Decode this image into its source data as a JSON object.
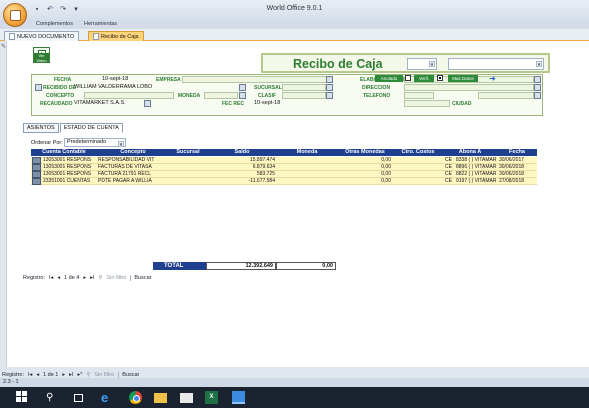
{
  "window": {
    "title": "World Office 9.0.1"
  },
  "colors": {
    "accent_green": "#2e7d32",
    "grid_header": "#1f3f8f",
    "row_fill": "#fff7c2"
  },
  "ribbon": {
    "tabs": [
      "Complementos",
      "Herramientas"
    ]
  },
  "document_tabs": [
    "NUEVO DOCUMENTO",
    "Recibo de Caja"
  ],
  "toolbar": {
    "ver_video_label": "Ver Video"
  },
  "document": {
    "title": "Recibo de Caja"
  },
  "form": {
    "fecha_label": "FECHA",
    "fecha_value": "10-sept-18",
    "empresa_label": "EMPRESA",
    "elaborado_label": "ELABORADO POR",
    "recibido_label": "RECIBIDO DE",
    "recibido_value": "WILLIAM VALDERRAMA LOBO",
    "sucursal_label": "SUCURSAL",
    "direccion_label": "DIRECCION",
    "concepto_label": "CONCEPTO",
    "moneda_label": "MONEDA",
    "clasif_label": "CLASIF",
    "telefono_label": "TELEFONO",
    "ciudad_label": "CIUDAD",
    "recaudado_label": "RECAUDADO",
    "recaudado_value": "VITAMARKET S.A.S.",
    "fec_rec_label": "FEC REC",
    "fec_rec_value": "10-sept-18",
    "anulado_label": "Anulado",
    "verif_label": "Verif.",
    "mas_datos_label": "Mas Datos",
    "anulado_checked": false,
    "verif_checked": true
  },
  "subtabs": [
    "ASIENTOS",
    "ESTADO DE CUENTA"
  ],
  "ordenar": {
    "label": "Ordenar Por:",
    "value": "Predeterminado"
  },
  "grid": {
    "columns": [
      "Cuenta Contable",
      "Concepto",
      "Sucursal",
      "Saldo",
      "Moneda",
      "Otras Monedas",
      "Ctro. Costos",
      "Abona A",
      "Fecha"
    ],
    "rows": [
      {
        "cuenta": "13053001 RESPONS",
        "concepto": "RESPONSABILIDAD VIT",
        "sucursal": "",
        "saldo": "15.897.474",
        "moneda": "",
        "otras": "0,00",
        "ctro": "CE",
        "abona": "8338 ( ) VITAMAR",
        "fecha": "30/06/2017"
      },
      {
        "cuenta": "13053001 RESPONS",
        "concepto": "FACTURAS DE VITASA",
        "sucursal": "",
        "saldo": "6.879.634",
        "moneda": "",
        "otras": "0,00",
        "ctro": "CE",
        "abona": "8896 ( ) VITAMAR",
        "fecha": "30/06/2018"
      },
      {
        "cuenta": "13053001 RESPONS",
        "concepto": "FACTURA 21791 RECL",
        "sucursal": "",
        "saldo": "583.725",
        "moneda": "",
        "otras": "0,00",
        "ctro": "CE",
        "abona": "8822 ( ) VITAMAR",
        "fecha": "30/06/2018"
      },
      {
        "cuenta": "23351001 CUENTAS",
        "concepto": "PDTE PAGAR A WILLIA",
        "sucursal": "",
        "saldo": "-11.677.584",
        "moneda": "",
        "otras": "0,00",
        "ctro": "CE",
        "abona": "9197 ( ) VITAMAR",
        "fecha": "27/08/2018"
      }
    ]
  },
  "totals": {
    "label": "TOTAL",
    "value": "12.392.649",
    "value2": "0,00"
  },
  "nav_inner": {
    "registro": "Registro:",
    "pos": "1 de 4",
    "sin_filtro": "Sin filtro",
    "buscar": "Buscar"
  },
  "nav_outer": {
    "registro": "Registro:",
    "pos": "1 de 1",
    "sin_filtro": "Sin filtro",
    "buscar": "Buscar"
  },
  "statusbar": {
    "text": "2.3 - 1"
  }
}
